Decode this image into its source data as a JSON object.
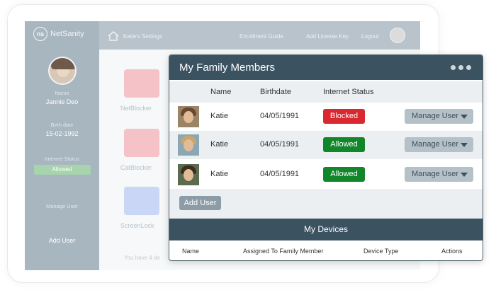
{
  "background": {
    "brand": "NetSanity",
    "logo_mark": "ns",
    "header": {
      "title": "Katie's Settings",
      "links": [
        "Enrollment Guide",
        "Add License Key",
        "Logout"
      ]
    },
    "profile": {
      "name_label": "Name",
      "name": "Jannie Deo",
      "birthdate_label": "Birth date",
      "birthdate": "15-02-1992",
      "status_label": "Internet Status",
      "status": "Allowed",
      "manage": "Manage User",
      "add": "Add User"
    },
    "tiles": [
      "NetBlocker",
      "CatBlocker",
      "ScreenLock"
    ],
    "footer_text": "You have 4 de"
  },
  "card": {
    "title": "My Family Members",
    "columns": [
      "Name",
      "Birthdate",
      "Internet Status"
    ],
    "rows": [
      {
        "name": "Katie",
        "birthdate": "04/05/1991",
        "status": "Blocked",
        "action": "Manage User"
      },
      {
        "name": "Katie",
        "birthdate": "04/05/1991",
        "status": "Allowed",
        "action": "Manage User"
      },
      {
        "name": "Katie",
        "birthdate": "04/05/1991",
        "status": "Allowed",
        "action": "Manage User"
      }
    ],
    "add_user": "Add User",
    "devices_title": "My Devices",
    "device_columns": [
      "Name",
      "Assigned To Family Member",
      "Device Type",
      "Actions"
    ]
  },
  "colors": {
    "header": "#3b5361",
    "blocked": "#d9282f",
    "allowed": "#12862b",
    "manage_button": "#b4c1c9"
  }
}
